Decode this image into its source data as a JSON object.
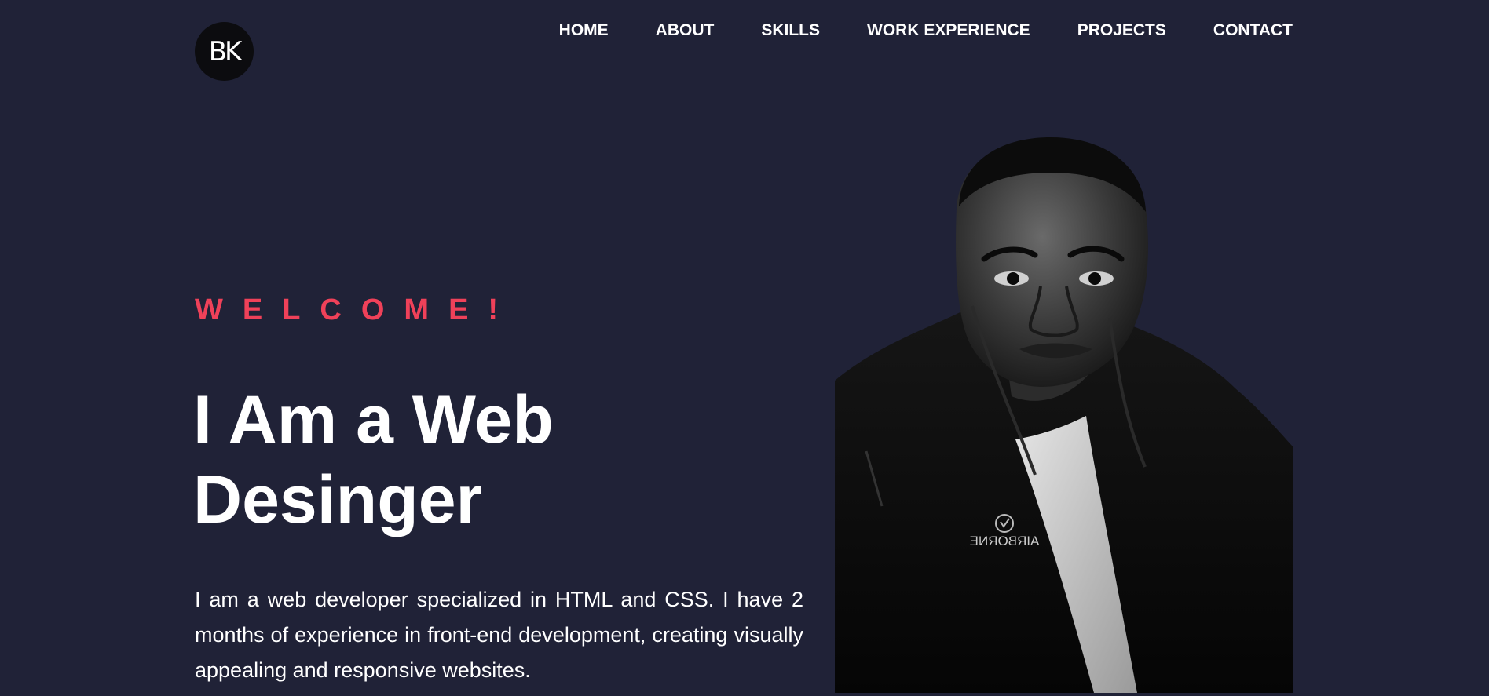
{
  "header": {
    "logo_text": "BK",
    "nav": [
      {
        "label": "HOME"
      },
      {
        "label": "ABOUT"
      },
      {
        "label": "SKILLS"
      },
      {
        "label": "WORK EXPERIENCE"
      },
      {
        "label": "PROJECTS"
      },
      {
        "label": "CONTACT"
      }
    ]
  },
  "hero": {
    "welcome": "WELCOME!",
    "headline": "I Am a Web Desinger",
    "intro": "I am a web developer specialized in HTML and CSS. I have 2 months of experience in front-end development, creating visually appealing and responsive websites.",
    "photo": {
      "jacket_text": "AIRBORNE"
    }
  },
  "colors": {
    "background": "#202237",
    "accent": "#ef4159",
    "text": "#ffffff",
    "logo_bg": "#0c0c0f"
  }
}
